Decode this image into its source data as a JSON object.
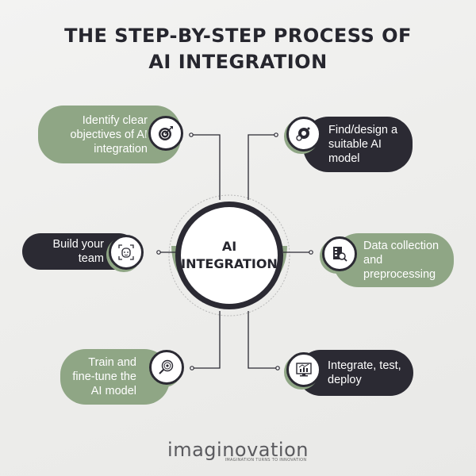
{
  "title": {
    "line1": "THE STEP-BY-STEP PROCESS OF",
    "line2": "AI INTEGRATION"
  },
  "center": {
    "line1": "AI",
    "line2": "INTEGRATION"
  },
  "steps": [
    {
      "label": "Identify clear objectives of AI integration",
      "icon": "target-icon",
      "color": "#8fa685",
      "side": "left"
    },
    {
      "label": "Find/design a suitable AI model",
      "icon": "gear-brain-icon",
      "color": "#2b2a33",
      "side": "right"
    },
    {
      "label": "Build your team",
      "icon": "face-scan-icon",
      "color": "#2b2a33",
      "side": "left"
    },
    {
      "label": "Data collection and preprocessing",
      "icon": "data-search-icon",
      "color": "#8fa685",
      "side": "right"
    },
    {
      "label": "Train and fine-tune the AI model",
      "icon": "magnifier-target-icon",
      "color": "#8fa685",
      "side": "left"
    },
    {
      "label": "Integrate, test, deploy",
      "icon": "monitor-chart-icon",
      "color": "#2b2a33",
      "side": "right"
    }
  ],
  "brand": {
    "name": "imaginovation",
    "tagline": "IMAGINATION TURNS TO INNOVATION"
  },
  "colors": {
    "green": "#8fa685",
    "dark": "#2b2a33",
    "background": "#efefed"
  }
}
